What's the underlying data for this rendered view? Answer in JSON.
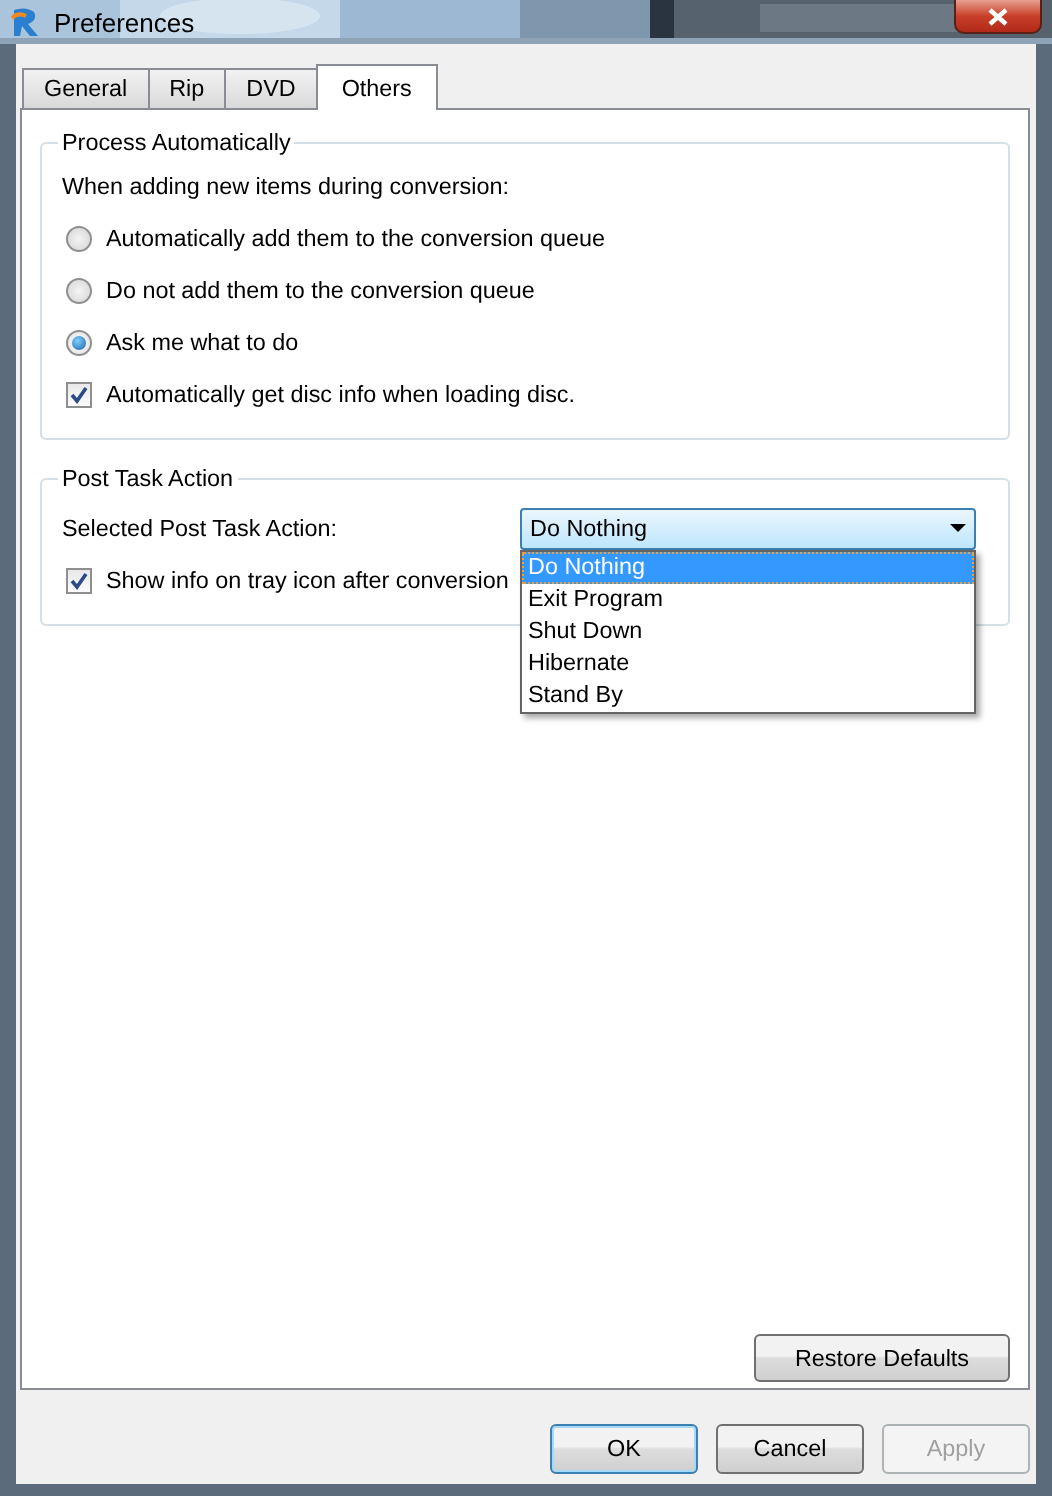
{
  "window": {
    "title": "Preferences"
  },
  "tabs": [
    {
      "label": "General",
      "selected": false
    },
    {
      "label": "Rip",
      "selected": false
    },
    {
      "label": "DVD",
      "selected": false
    },
    {
      "label": "Others",
      "selected": true
    }
  ],
  "groups": [
    {
      "title": "Process Automatically",
      "items": [
        {
          "kind": "text",
          "label": "When adding new items during conversion:"
        },
        {
          "kind": "radio",
          "label": "Automatically add them to the conversion queue",
          "selected": false
        },
        {
          "kind": "radio",
          "label": "Do not add them to the conversion queue",
          "selected": false
        },
        {
          "kind": "radio",
          "label": "Ask me what to do",
          "selected": true
        },
        {
          "kind": "checkbox",
          "label": "Automatically get disc info when loading disc.",
          "checked": true
        }
      ]
    },
    {
      "title": "Post Task Action",
      "items": [
        {
          "kind": "dropdown",
          "label": "Selected Post Task Action:",
          "value": "Do Nothing",
          "expanded": true,
          "options": [
            {
              "label": "Do Nothing",
              "selected": true
            },
            {
              "label": "Exit Program",
              "selected": false
            },
            {
              "label": "Shut Down",
              "selected": false
            },
            {
              "label": "Hibernate",
              "selected": false
            },
            {
              "label": "Stand By",
              "selected": false
            }
          ]
        },
        {
          "kind": "checkbox",
          "label": "Show info on tray icon after conversion",
          "checked": true
        }
      ]
    }
  ],
  "restore_button": {
    "label": "Restore Defaults"
  },
  "buttons": [
    {
      "label": "OK",
      "default": true,
      "disabled": false
    },
    {
      "label": "Cancel",
      "default": false,
      "disabled": false
    },
    {
      "label": "Apply",
      "default": false,
      "disabled": true
    }
  ]
}
